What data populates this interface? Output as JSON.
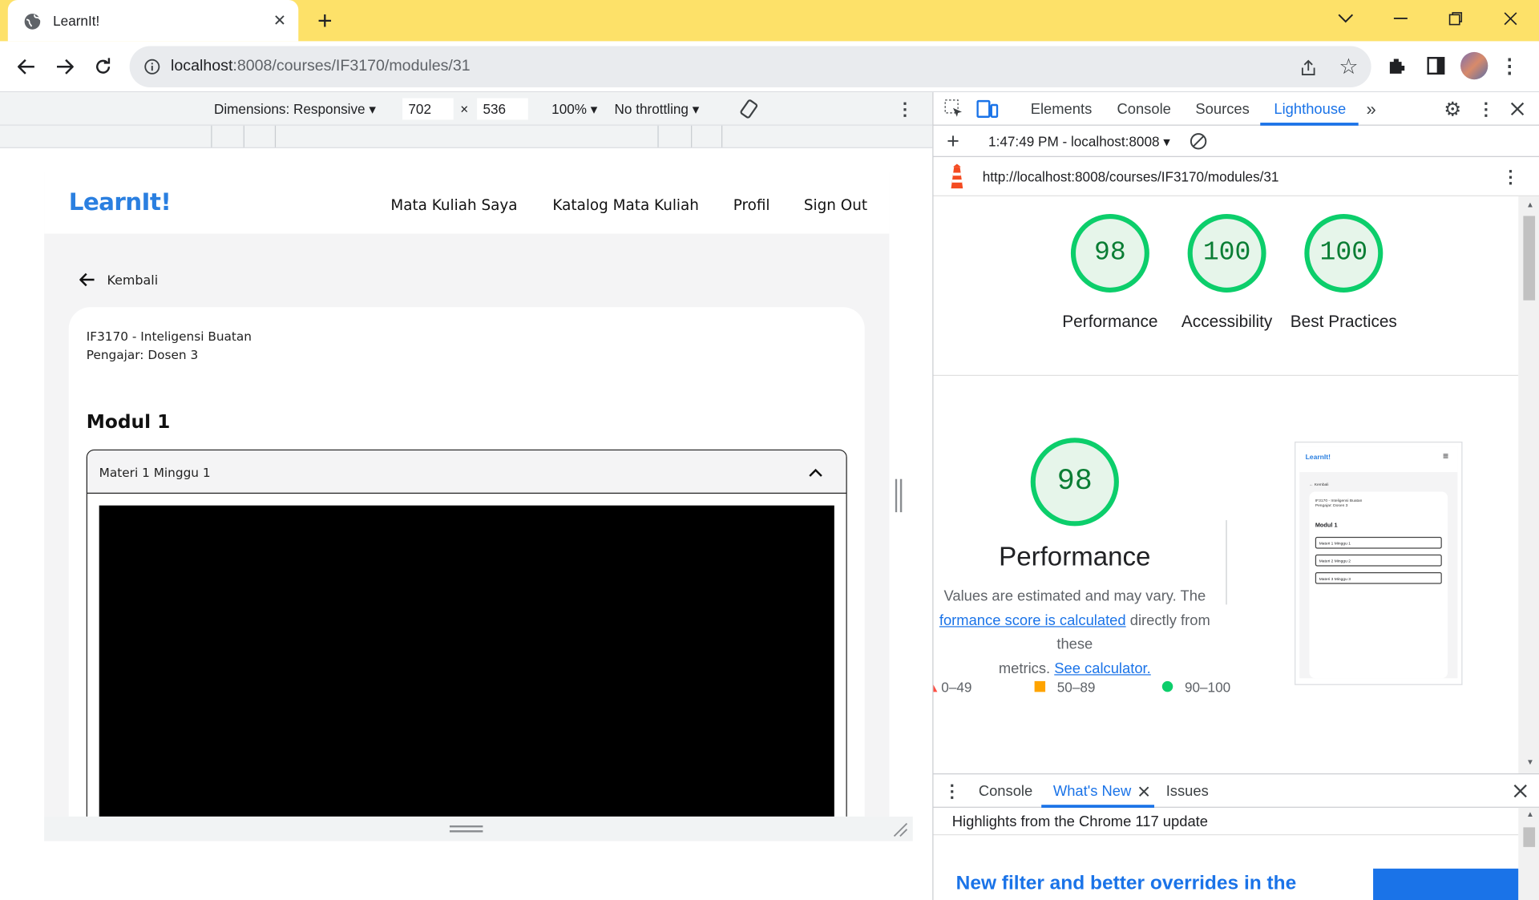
{
  "browser": {
    "tab_title": "LearnIt!",
    "url_host": "localhost",
    "url_path": ":8008/courses/IF3170/modules/31"
  },
  "device_toolbar": {
    "dimensions_label": "Dimensions: Responsive",
    "width": "702",
    "height": "536",
    "times": "×",
    "zoom": "100%",
    "throttling": "No throttling"
  },
  "site": {
    "logo": "LearnIt!",
    "nav": [
      "Mata Kuliah Saya",
      "Katalog Mata Kuliah",
      "Profil",
      "Sign Out"
    ],
    "back_label": "Kembali",
    "course_line": "IF3170 - Inteligensi Buatan",
    "teacher_line": "Pengajar: Dosen 3",
    "module_title": "Modul 1",
    "accordion_title": "Materi 1 Minggu 1"
  },
  "devtools": {
    "tabs": [
      "Elements",
      "Console",
      "Sources",
      "Lighthouse"
    ],
    "active_tab": "Lighthouse",
    "report_selector": "1:47:49 PM - localhost:8008",
    "report_url": "http://localhost:8008/courses/IF3170/modules/31",
    "scores": [
      {
        "label": "Performance",
        "value": "98"
      },
      {
        "label": "Accessibility",
        "value": "100"
      },
      {
        "label": "Best Practices",
        "value": "100"
      }
    ],
    "perf_score": "98",
    "perf_title": "Performance",
    "perf_desc_1": "Values are estimated and may vary. The",
    "perf_link_1": "formance score is calculated",
    "perf_desc_2": "directly from these",
    "perf_desc_3": "metrics.",
    "perf_link_2": "See calculator.",
    "legend": [
      "0–49",
      "50–89",
      "90–100"
    ],
    "drawer_tabs": [
      "Console",
      "What's New",
      "Issues"
    ],
    "drawer_active": "What's New",
    "drawer_highlight": "Highlights from the Chrome 117 update",
    "drawer_heading": "New filter and better overrides in the",
    "thumb_logo": "LearnIt!",
    "thumb_back": "Kembali",
    "thumb_course": "IF3170 - Inteligensi Buatan",
    "thumb_teacher": "Pengajar: Dosen 3",
    "thumb_module": "Modul 1",
    "thumb_items": [
      "Materi 1 Minggu 1",
      "Materi 2 Minggu 2",
      "Materi 3 Minggu 3"
    ]
  },
  "colors": {
    "tabbar": "#fde169",
    "brand": "#2a7fe0",
    "pass": "#0cce6b",
    "average": "#ffa400",
    "link": "#1a73e8"
  }
}
